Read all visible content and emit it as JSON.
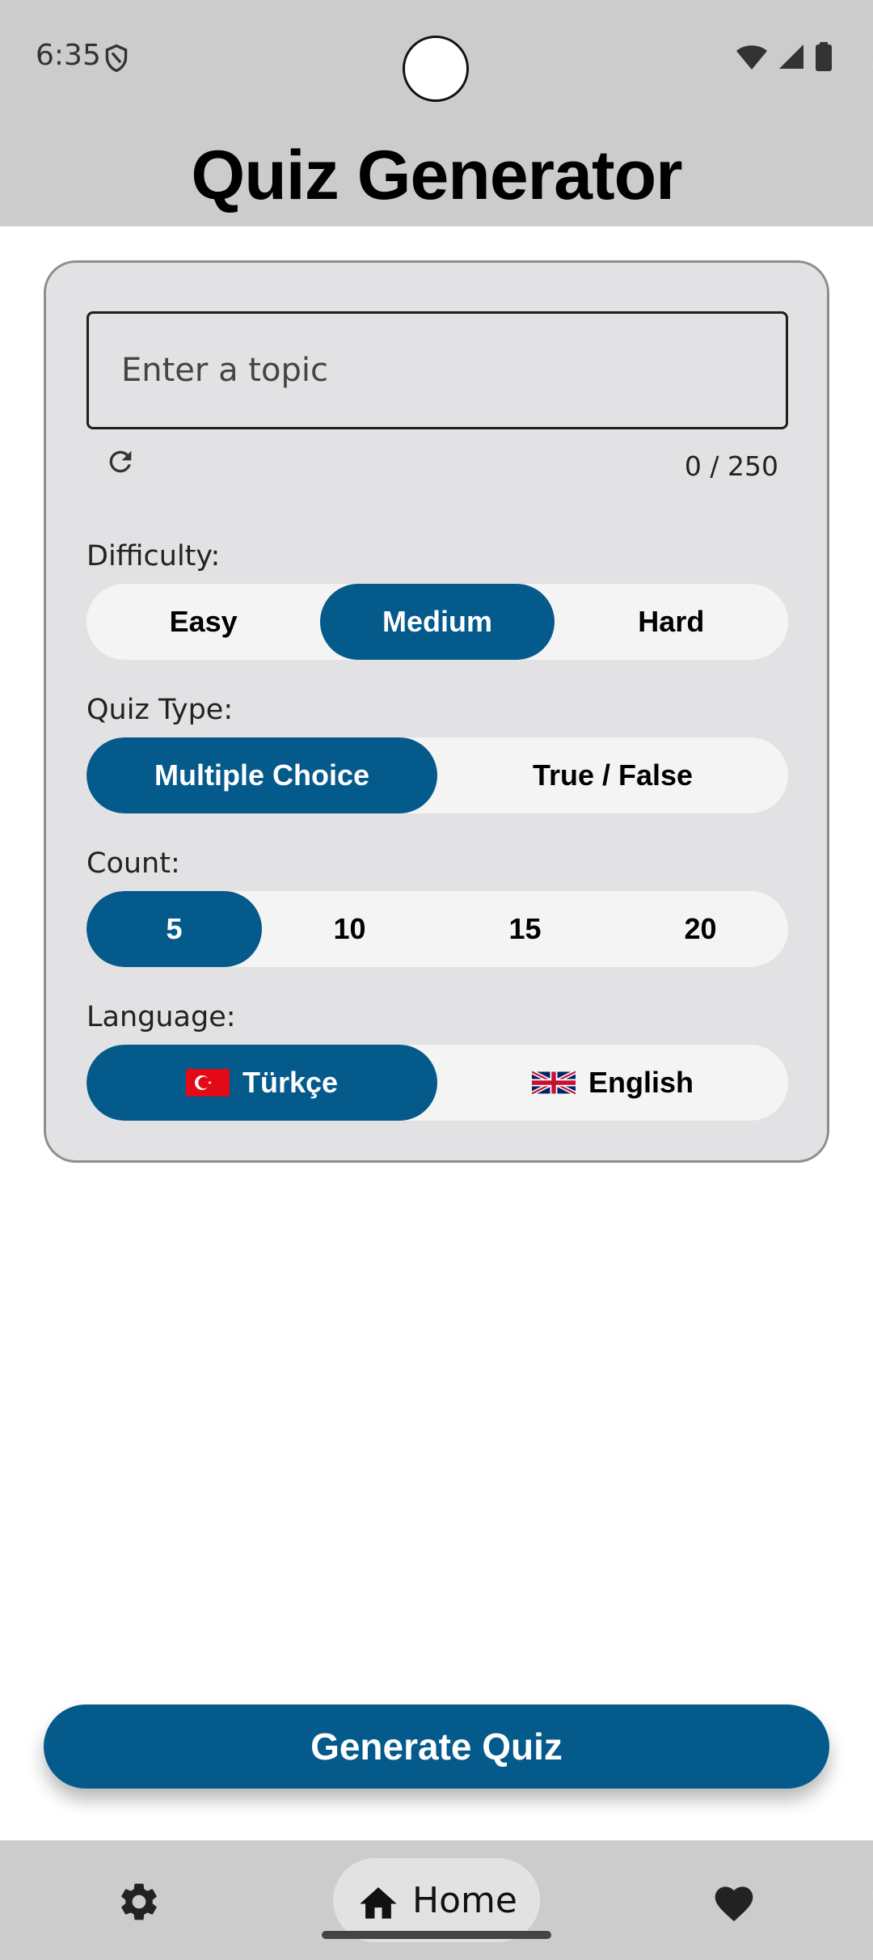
{
  "status_bar": {
    "time": "6:35",
    "icons": [
      "shield-icon",
      "wifi-icon",
      "signal-icon",
      "battery-icon"
    ]
  },
  "header": {
    "title": "Quiz Generator"
  },
  "topic": {
    "placeholder": "Enter a topic",
    "value": "",
    "char_count": "0 / 250",
    "refresh_icon": "refresh-icon"
  },
  "difficulty": {
    "label": "Difficulty:",
    "options": [
      "Easy",
      "Medium",
      "Hard"
    ],
    "selected": "Medium"
  },
  "quiz_type": {
    "label": "Quiz Type:",
    "options": [
      "Multiple Choice",
      "True / False"
    ],
    "selected": "Multiple Choice"
  },
  "count": {
    "label": "Count:",
    "options": [
      "5",
      "10",
      "15",
      "20"
    ],
    "selected": "5"
  },
  "language": {
    "label": "Language:",
    "options": [
      "Türkçe",
      "English"
    ],
    "flags": [
      "turkey-flag-icon",
      "uk-flag-icon"
    ],
    "selected": "Türkçe"
  },
  "generate_button": {
    "label": "Generate Quiz"
  },
  "bottom_nav": {
    "items": [
      {
        "icon": "gear-icon",
        "label": ""
      },
      {
        "icon": "home-icon",
        "label": "Home"
      },
      {
        "icon": "heart-icon",
        "label": ""
      }
    ],
    "active": "Home"
  },
  "colors": {
    "accent": "#055a8c",
    "header_bg": "#cccccc",
    "card_bg": "#e2e2e5",
    "segment_bg": "#f4f4f4"
  }
}
